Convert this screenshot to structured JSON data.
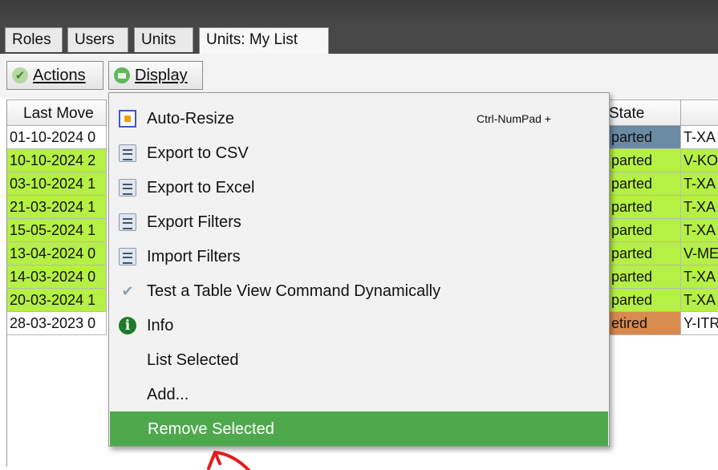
{
  "tabs": [
    {
      "label": "Roles",
      "active": false
    },
    {
      "label": "Users",
      "active": false
    },
    {
      "label": "Units",
      "active": false
    },
    {
      "label": "Units: My List",
      "active": true
    }
  ],
  "toolbar": {
    "actions_label": "Actions",
    "actions_icon": "checkmark-icon",
    "display_label": "Display",
    "display_icon": "display-icon"
  },
  "grid": {
    "headers": {
      "last_move": "Last Move",
      "state": "State",
      "next": ""
    },
    "rows": [
      {
        "date": "01-10-2024 0",
        "state": "parted",
        "reg": "T-XA",
        "color": "#ffffff",
        "state_color": "#6b8aa3"
      },
      {
        "date": "10-10-2024 2",
        "state": "parted",
        "reg": "V-KO",
        "color": "#b5f044",
        "state_color": "#b5f044"
      },
      {
        "date": "03-10-2024 1",
        "state": "parted",
        "reg": "T-XA",
        "color": "#b5f044",
        "state_color": "#b5f044"
      },
      {
        "date": "21-03-2024 1",
        "state": "parted",
        "reg": "T-XA",
        "color": "#b5f044",
        "state_color": "#b5f044"
      },
      {
        "date": "15-05-2024 1",
        "state": "parted",
        "reg": "T-XA",
        "color": "#b5f044",
        "state_color": "#b5f044"
      },
      {
        "date": "13-04-2024 0",
        "state": "parted",
        "reg": "V-ME",
        "color": "#b5f044",
        "state_color": "#b5f044"
      },
      {
        "date": "14-03-2024 0",
        "state": "parted",
        "reg": "T-XA",
        "color": "#b5f044",
        "state_color": "#b5f044"
      },
      {
        "date": "20-03-2024 1",
        "state": "parted",
        "reg": "T-XA",
        "color": "#b5f044",
        "state_color": "#b5f044"
      },
      {
        "date": "28-03-2023 0",
        "state": "etired",
        "reg": "Y-ITR",
        "color": "#ffffff",
        "state_color": "#d98a4e"
      }
    ]
  },
  "menu": {
    "items": [
      {
        "label": "Auto-Resize",
        "shortcut": "Ctrl-NumPad +",
        "icon": "auto-resize-icon"
      },
      {
        "label": "Export to CSV",
        "shortcut": "",
        "icon": "document-icon"
      },
      {
        "label": "Export to Excel",
        "shortcut": "",
        "icon": "document-icon"
      },
      {
        "label": "Export Filters",
        "shortcut": "",
        "icon": "document-icon"
      },
      {
        "label": "Import Filters",
        "shortcut": "",
        "icon": "document-icon"
      },
      {
        "label": "Test a Table View Command Dynamically",
        "shortcut": "",
        "icon": "checkmark-icon"
      },
      {
        "label": "Info",
        "shortcut": "",
        "icon": "info-icon"
      },
      {
        "label": "List Selected",
        "shortcut": "",
        "icon": ""
      },
      {
        "label": "Add...",
        "shortcut": "",
        "icon": ""
      },
      {
        "label": "Remove Selected",
        "shortcut": "",
        "icon": "",
        "highlighted": true
      }
    ]
  },
  "colors": {
    "menu_highlight": "#4ea94d",
    "row_green": "#b5f044",
    "retired_orange": "#d98a4e",
    "annotation_red": "#e21b1b"
  }
}
